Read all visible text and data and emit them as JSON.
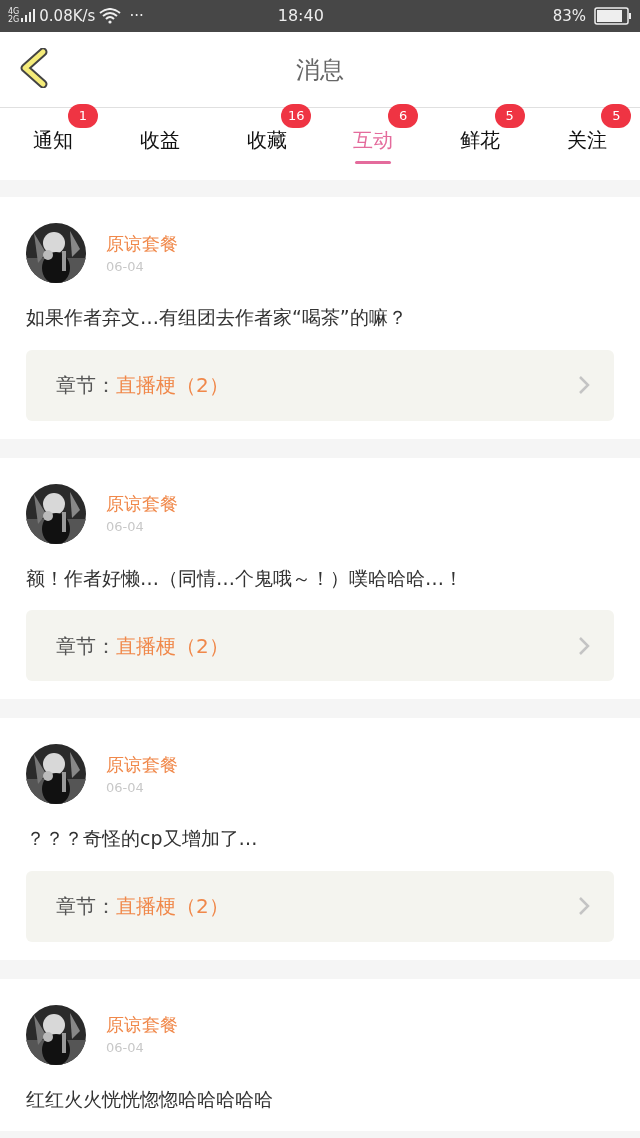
{
  "status_bar": {
    "network_top": "4G",
    "network_bottom": "2G",
    "speed": "0.08K/s",
    "more": "···",
    "time": "18:40",
    "battery": "83%"
  },
  "header": {
    "title": "消息"
  },
  "tabs": [
    {
      "label": "通知",
      "badge": "1",
      "selected": false
    },
    {
      "label": "收益",
      "selected": false
    },
    {
      "label": "收藏",
      "badge": "16",
      "selected": false
    },
    {
      "label": "互动",
      "badge": "6",
      "selected": true
    },
    {
      "label": "鲜花",
      "badge": "5",
      "selected": false
    },
    {
      "label": "关注",
      "badge": "5",
      "selected": false
    }
  ],
  "messages": [
    {
      "user": "原谅套餐",
      "date": "06-04",
      "text": "如果作者弃文…有组团去作者家“喝茶”的嘛？",
      "chapter_label": "章节：",
      "chapter": "直播梗（2）"
    },
    {
      "user": "原谅套餐",
      "date": "06-04",
      "text": "额！作者好懒…（同情…个鬼哦～！）噗哈哈哈…！",
      "chapter_label": "章节：",
      "chapter": "直播梗（2）"
    },
    {
      "user": "原谅套餐",
      "date": "06-04",
      "text": "？？？奇怪的cp又增加了…",
      "chapter_label": "章节：",
      "chapter": "直播梗（2）"
    },
    {
      "user": "原谅套餐",
      "date": "06-04",
      "text": "红红火火恍恍惚惚哈哈哈哈哈"
    }
  ]
}
